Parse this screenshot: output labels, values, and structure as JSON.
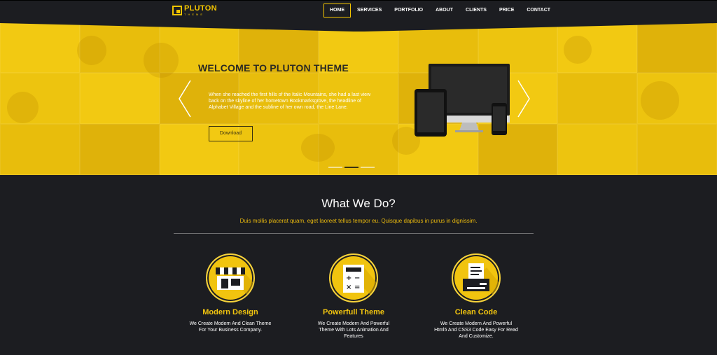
{
  "brand": {
    "name": "PLUTON",
    "tagline": "THEME"
  },
  "nav": {
    "items": [
      {
        "label": "HOME",
        "active": true
      },
      {
        "label": "SERVICES",
        "active": false
      },
      {
        "label": "PORTFOLIO",
        "active": false
      },
      {
        "label": "ABOUT",
        "active": false
      },
      {
        "label": "CLIENTS",
        "active": false
      },
      {
        "label": "PRICE",
        "active": false
      },
      {
        "label": "CONTACT",
        "active": false
      }
    ]
  },
  "hero": {
    "title": "WELCOME TO PLUTON THEME",
    "text": "When she reached the first hills of the Italic Mountains, she had a last view back on the skyline of her hometown Bookmarksgrove, the headline of Alphabet Village and the subline of her own road, the Line Lane.",
    "button_label": "Download",
    "slides": 3,
    "active_slide": 1
  },
  "services": {
    "title": "What We Do?",
    "subtitle": "Duis mollis placerat quam, eget laoreet tellus tempor eu. Quisque dapibus in purus in dignissim.",
    "items": [
      {
        "icon": "storefront-icon",
        "title": "Modern Design",
        "text": "We Create Modern And Clean Theme For Your Business Company."
      },
      {
        "icon": "calculator-icon",
        "title": "Powerfull Theme",
        "text": "We Create Modern And Powerful Theme With Lots Animation And Features"
      },
      {
        "icon": "printer-icon",
        "title": "Clean Code",
        "text": "We Create Modern And Powerful Html5 And CSS3 Code Easy For Read And Customize."
      }
    ]
  },
  "colors": {
    "accent": "#f1c40f",
    "background": "#1c1d21",
    "text": "#ffffff"
  }
}
